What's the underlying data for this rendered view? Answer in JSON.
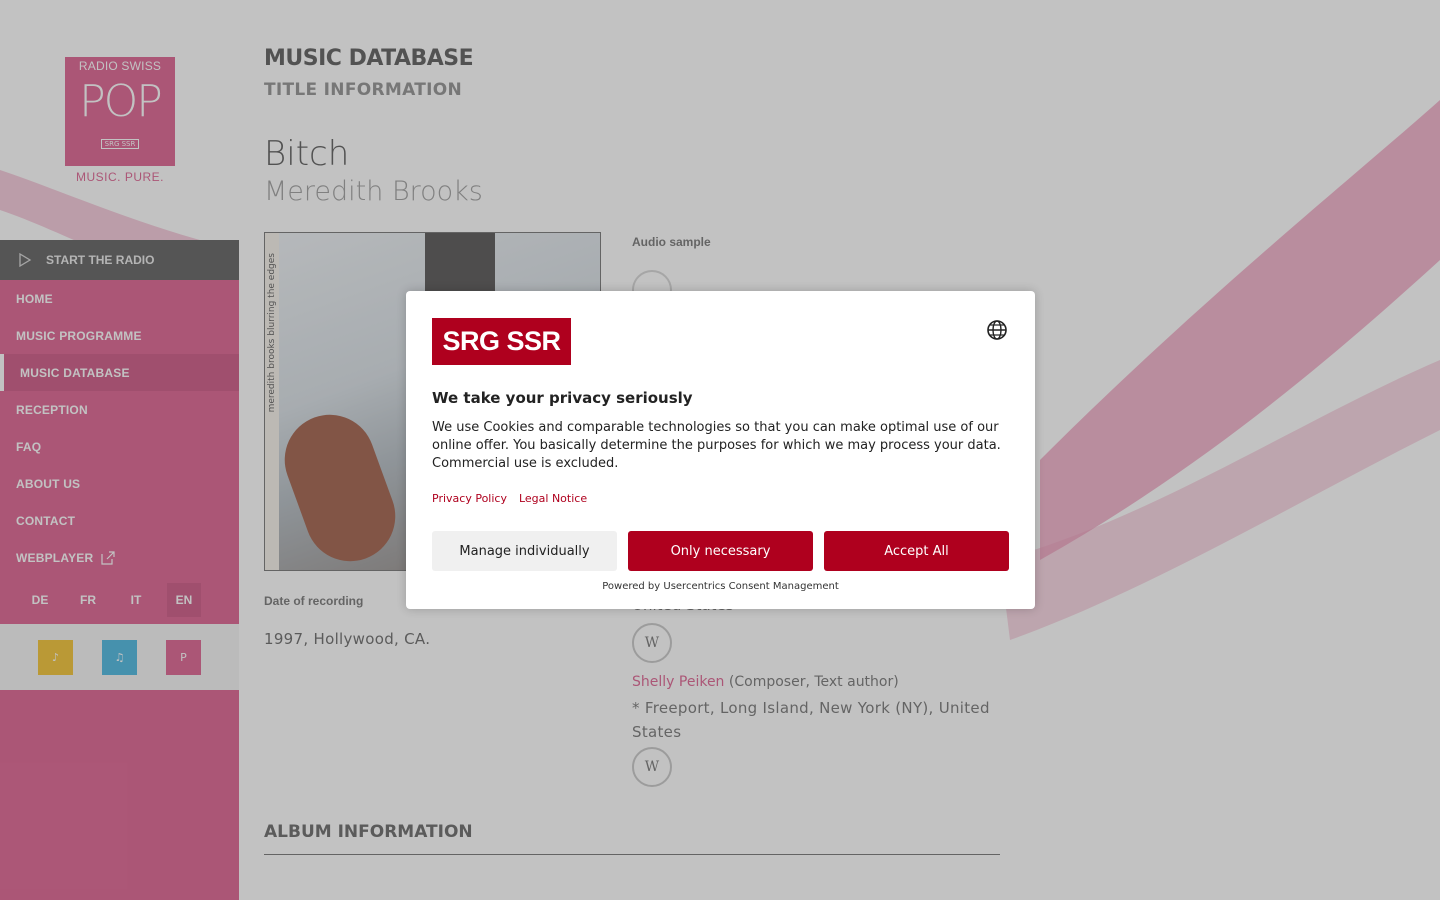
{
  "sidebar": {
    "logo": {
      "top": "RADIO SWISS",
      "main": "POP",
      "badge": "SRG SSR",
      "tagline": "MUSIC. PURE."
    },
    "start_radio": "START THE RADIO",
    "nav": [
      {
        "label": "HOME"
      },
      {
        "label": "MUSIC PROGRAMME"
      },
      {
        "label": "MUSIC DATABASE",
        "active": true
      },
      {
        "label": "RECEPTION"
      },
      {
        "label": "FAQ"
      },
      {
        "label": "ABOUT US"
      },
      {
        "label": "CONTACT"
      },
      {
        "label": "WEBPLAYER"
      }
    ],
    "languages": [
      "DE",
      "FR",
      "IT",
      "EN"
    ],
    "active_language": "EN",
    "stations": [
      "jazz-station-icon",
      "classic-station-icon",
      "pop-station-icon"
    ]
  },
  "main": {
    "heading": "MUSIC DATABASE",
    "subheading": "TITLE INFORMATION",
    "title": "Bitch",
    "artist": "Meredith Brooks",
    "cover_text": "meredith brooks  blurring the edges",
    "audio_label": "Audio sample",
    "date_label": "Date of recording",
    "date_value": "1997, Hollywood, CA.",
    "country_partial": "United States",
    "wiki_label": "W",
    "composer_name": "Shelly Peiken",
    "composer_roles": " (Composer, Text author)",
    "composer_origin": "* Freeport, Long Island, New York (NY), United States",
    "album_heading": "ALBUM INFORMATION"
  },
  "consent": {
    "logo": "SRG SSR",
    "title": "We take your privacy seriously",
    "text": "We use Cookies and comparable technologies so that you can make optimal use of our online offer. You basically determine the purposes for which we may process your data. Commercial use is excluded.",
    "links": {
      "privacy": "Privacy Policy",
      "legal": "Legal Notice"
    },
    "buttons": {
      "manage": "Manage individually",
      "necessary": "Only necessary",
      "accept": "Accept All"
    },
    "powered": "Powered by Usercentrics Consent Management",
    "accent": "#af001e"
  },
  "colors": {
    "brand_pink": "#d63b76",
    "sidebar_dark": "#3a3a3a"
  }
}
